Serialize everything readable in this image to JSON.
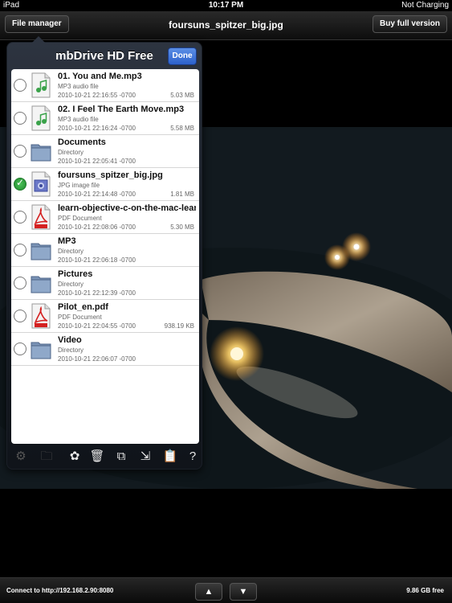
{
  "statusbar": {
    "carrier": "iPad",
    "time": "10:17 PM",
    "battery": "Not Charging"
  },
  "navbar": {
    "left_button": "File manager",
    "title": "foursuns_spitzer_big.jpg",
    "right_button": "Buy full version"
  },
  "popover": {
    "title": "mbDrive HD Free",
    "done_label": "Done",
    "files": [
      {
        "name": "01. You and Me.mp3",
        "type": "MP3 audio file",
        "date": "2010-10-21 22:16:55 -0700",
        "size": "5.03 MB",
        "icon": "mp3-icon",
        "checked": false
      },
      {
        "name": "02. I Feel The Earth Move.mp3",
        "type": "MP3 audio file",
        "date": "2010-10-21 22:16:24 -0700",
        "size": "5.58 MB",
        "icon": "mp3-icon",
        "checked": false
      },
      {
        "name": "Documents",
        "type": "Directory",
        "date": "2010-10-21 22:05:41 -0700",
        "size": "",
        "icon": "folder-icon",
        "checked": false
      },
      {
        "name": "foursuns_spitzer_big.jpg",
        "type": "JPG image file",
        "date": "2010-10-21 22:14:48 -0700",
        "size": "1.81 MB",
        "icon": "jpg-icon",
        "checked": true
      },
      {
        "name": "learn-objective-c-on-the-mac-lear",
        "type": "PDF Document",
        "date": "2010-10-21 22:08:06 -0700",
        "size": "5.30 MB",
        "icon": "pdf-icon",
        "checked": false
      },
      {
        "name": "MP3",
        "type": "Directory",
        "date": "2010-10-21 22:06:18 -0700",
        "size": "",
        "icon": "folder-icon",
        "checked": false
      },
      {
        "name": "Pictures",
        "type": "Directory",
        "date": "2010-10-21 22:12:39 -0700",
        "size": "",
        "icon": "folder-icon",
        "checked": false
      },
      {
        "name": "Pilot_en.pdf",
        "type": "PDF Document",
        "date": "2010-10-21 22:04:55 -0700",
        "size": "938.19 KB",
        "icon": "pdf-icon",
        "checked": false
      },
      {
        "name": "Video",
        "type": "Directory",
        "date": "2010-10-21 22:06:07 -0700",
        "size": "",
        "icon": "folder-icon",
        "checked": false
      }
    ],
    "tools": [
      {
        "name": "settings-gear-icon",
        "glyph": "⚙",
        "enabled": false
      },
      {
        "name": "new-folder-icon",
        "glyph": "🗀",
        "enabled": false
      },
      {
        "name": "flower-icon",
        "glyph": "✿",
        "enabled": true
      },
      {
        "name": "trash-icon",
        "glyph": "🗑",
        "enabled": true
      },
      {
        "name": "copy-icon",
        "glyph": "⧉",
        "enabled": true
      },
      {
        "name": "move-icon",
        "glyph": "⇲",
        "enabled": true
      },
      {
        "name": "paste-icon",
        "glyph": "📋",
        "enabled": true
      },
      {
        "name": "help-icon",
        "glyph": "?",
        "enabled": true
      }
    ]
  },
  "bottombar": {
    "connection": "Connect to http://192.168.2.90:8080",
    "free_space": "9.86 GB free",
    "up_glyph": "▲",
    "down_glyph": "▼"
  }
}
